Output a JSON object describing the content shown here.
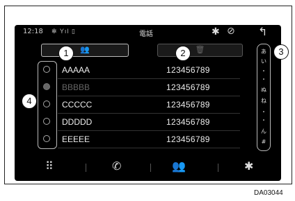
{
  "status_bar": {
    "time": "12:18",
    "status_icons": "✻ Yıl ▯",
    "title": "電話",
    "bluetooth_glyph": "✱",
    "no_line_glyph": "⊘",
    "back_glyph": "↰"
  },
  "toolbar": {
    "contacts_glyph": "👥",
    "delete_glyph": "🗑"
  },
  "contacts": [
    {
      "name": "AAAAA",
      "number": "123456789",
      "selected": false
    },
    {
      "name": "BBBBB",
      "number": "123456789",
      "selected": true
    },
    {
      "name": "CCCCC",
      "number": "123456789",
      "selected": false
    },
    {
      "name": "DDDDD",
      "number": "123456789",
      "selected": false
    },
    {
      "name": "EEEEE",
      "number": "123456789",
      "selected": false
    }
  ],
  "index_bar": [
    "あ",
    "い",
    "・",
    "・",
    "ぬ",
    "ね",
    "・",
    "・",
    "ん",
    "#"
  ],
  "bottom_nav": {
    "keypad_glyph": "⠿",
    "history_glyph": "✆",
    "contacts_glyph": "👥",
    "bluetooth_glyph": "✱"
  },
  "callouts": [
    "1",
    "2",
    "3",
    "4"
  ],
  "caption": "DA03044"
}
